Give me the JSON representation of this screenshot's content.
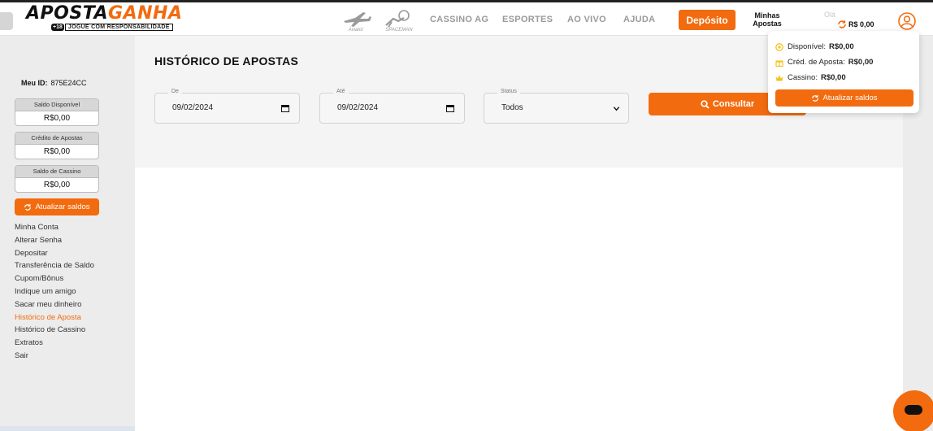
{
  "brand": {
    "logo_part1": "APOSTA",
    "logo_part2": "GANHA",
    "badge_18": "+18",
    "tagline": "JOGUE COM RESPONSABILIDADE"
  },
  "games": [
    {
      "label": "Aviator"
    },
    {
      "label": "SPACEMAN"
    }
  ],
  "nav": {
    "items": [
      "CASSINO AG",
      "ESPORTES",
      "AO VIVO",
      "AJUDA"
    ]
  },
  "header": {
    "deposit_label": "Depósito",
    "my_bets_line1": "Minhas",
    "my_bets_line2": "Apostas",
    "greeting": "Olá",
    "balance": "R$ 0,00"
  },
  "sidebar": {
    "id_label": "Meu ID:",
    "id_value": "875E24CC",
    "balances": [
      {
        "label": "Saldo Disponível",
        "value": "R$0,00"
      },
      {
        "label": "Crédito de Apostas",
        "value": "R$0,00"
      },
      {
        "label": "Saldo de Cassino",
        "value": "R$0,00"
      }
    ],
    "refresh_label": "Atualizar saldos",
    "menu": [
      "Minha Conta",
      "Alterar Senha",
      "Depositar",
      "Transferência de Saldo",
      "Cupom/Bônus",
      "Indique um amigo",
      "Sacar meu dinheiro",
      "Histórico de Aposta",
      "Histórico de Cassino",
      "Extratos",
      "Sair"
    ],
    "active_item": "Histórico de Aposta"
  },
  "main": {
    "title_bold": "HISTÓRICO",
    "title_rest": "DE APOSTAS",
    "from_label": "De",
    "from_value": "09/02/2024",
    "to_label": "Até",
    "to_value": "09/02/2024",
    "status_label": "Status",
    "status_value": "Todos",
    "consult_label": "Consultar"
  },
  "popup": {
    "rows": [
      {
        "label": "Disponível:",
        "value": "R$0,00",
        "icon": "coin-icon"
      },
      {
        "label": "Créd. de Aposta:",
        "value": "R$0,00",
        "icon": "gift-icon"
      },
      {
        "label": "Cassino:",
        "value": "R$0,00",
        "icon": "crown-icon"
      }
    ],
    "refresh_label": "Atualizar saldos"
  },
  "colors": {
    "accent": "#f26b0f",
    "sidebar_bg": "#ececec",
    "filter_bg": "#f4f4f4",
    "text": "#222222",
    "coin": "#f2c318"
  }
}
